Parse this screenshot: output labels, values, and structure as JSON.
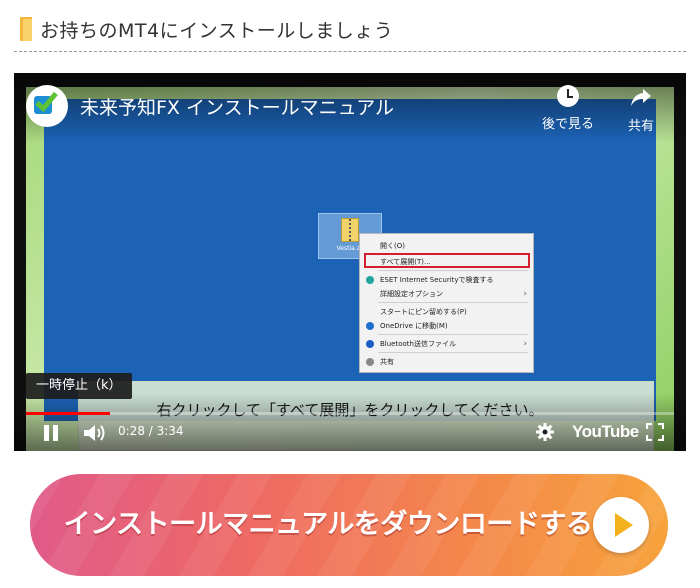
{
  "section": {
    "heading": "お持ちのMT4にインストールしましょう",
    "icon": "folder-icon"
  },
  "video": {
    "title": "未来予知FX インストールマニュアル",
    "watch_later_label": "後で見る",
    "share_label": "共有",
    "tooltip": "一時停止（k）",
    "subtitle": "右クリックして「すべて展開」をクリックしてください。",
    "time_display": "0:28 / 3:34",
    "progress_fraction": 0.13,
    "brand": "YouTube",
    "progress_color": "#ff0000",
    "desktop": {
      "file_name": "Vestia.zip",
      "context_menu": [
        {
          "label": "開く(O)",
          "icon": "",
          "submenu": false
        },
        {
          "label": "すべて展開(T)...",
          "icon": "",
          "submenu": false,
          "highlighted": true
        },
        {
          "label": "ESET Internet Securityで検査する",
          "icon": "eset-icon",
          "submenu": false
        },
        {
          "label": "詳細設定オプション",
          "icon": "",
          "submenu": true
        },
        {
          "label": "スタートにピン留めする(P)",
          "icon": "",
          "submenu": false
        },
        {
          "label": "OneDrive に移動(M)",
          "icon": "onedrive-icon",
          "submenu": false
        },
        {
          "label": "Bluetooth送信ファイル",
          "icon": "bluetooth-icon",
          "submenu": true
        },
        {
          "label": "共有",
          "icon": "share-icon",
          "submenu": false
        }
      ]
    }
  },
  "download_button": {
    "label": "インストールマニュアルをダウンロードする",
    "icon": "play-icon"
  }
}
